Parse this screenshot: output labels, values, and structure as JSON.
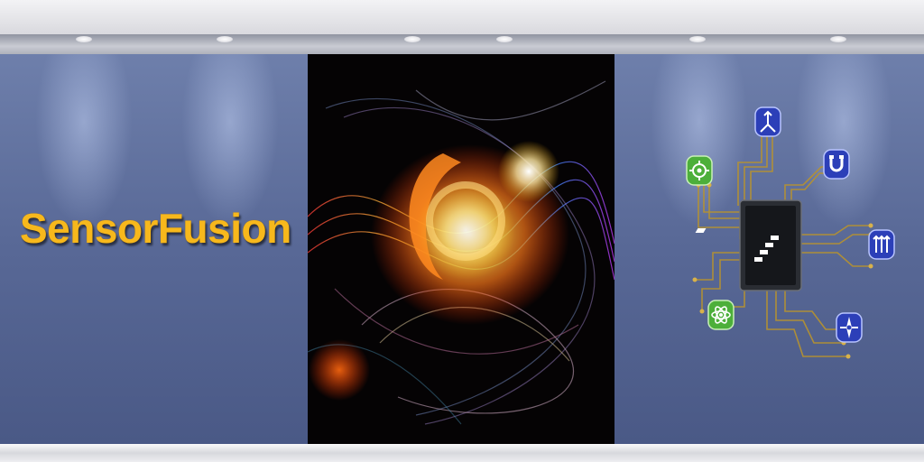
{
  "banner": {
    "title": "SensorFusion"
  },
  "palette": {
    "wall": "#586896",
    "title_text": "#f7b81c",
    "sensor_green": "#4caf3a",
    "sensor_blue": "#2c3fb8",
    "trace_gold": "#b8932e",
    "chip": "#15171b"
  },
  "diagram": {
    "chip_icon": "chevron-logo-icon",
    "sensors": [
      {
        "icon": "gear-icon",
        "color": "green"
      },
      {
        "icon": "arrows-icon",
        "color": "blue"
      },
      {
        "icon": "magnet-icon",
        "color": "blue"
      },
      {
        "icon": "pressure-icon",
        "color": "blue"
      },
      {
        "icon": "atom-icon",
        "color": "green"
      },
      {
        "icon": "compass-icon",
        "color": "blue"
      }
    ]
  }
}
